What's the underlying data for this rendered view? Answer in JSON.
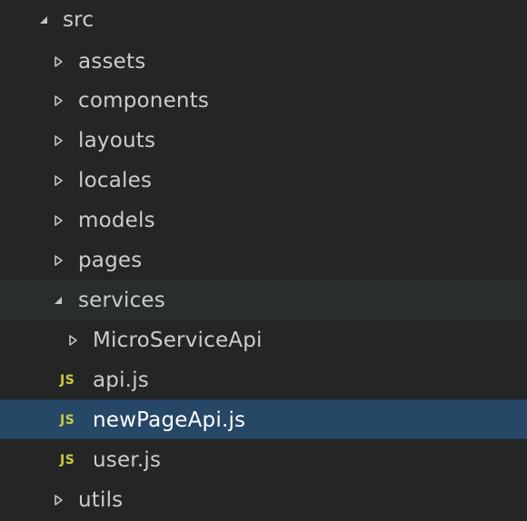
{
  "explorer": {
    "root": {
      "label": "src",
      "expanded": true
    },
    "items": [
      {
        "label": "assets",
        "type": "folder",
        "expanded": false
      },
      {
        "label": "components",
        "type": "folder",
        "expanded": false
      },
      {
        "label": "layouts",
        "type": "folder",
        "expanded": false
      },
      {
        "label": "locales",
        "type": "folder",
        "expanded": false
      },
      {
        "label": "models",
        "type": "folder",
        "expanded": false
      },
      {
        "label": "pages",
        "type": "folder",
        "expanded": false
      },
      {
        "label": "services",
        "type": "folder",
        "expanded": true
      },
      {
        "label": "MicroServiceApi",
        "type": "folder",
        "expanded": false
      },
      {
        "label": "api.js",
        "type": "file",
        "icon": "JS"
      },
      {
        "label": "newPageApi.js",
        "type": "file",
        "icon": "JS",
        "selected": true
      },
      {
        "label": "user.js",
        "type": "file",
        "icon": "JS"
      },
      {
        "label": "utils",
        "type": "folder",
        "expanded": false
      }
    ]
  },
  "colors": {
    "background": "#252526",
    "hover_row": "#2a2d2e",
    "selected_row": "#264766",
    "text": "#cccccc",
    "js_icon": "#cbcb41"
  }
}
